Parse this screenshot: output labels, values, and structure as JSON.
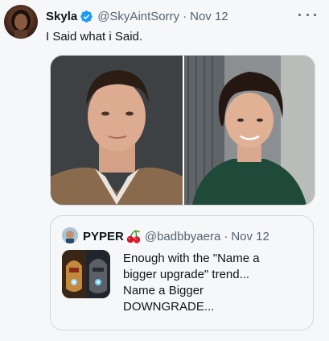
{
  "tweet": {
    "author": {
      "display_name": "Skyla",
      "handle": "@SkyAintSorry",
      "verified": true
    },
    "date": "Nov 12",
    "separator": "·",
    "text": "I Said what i Said.",
    "media_count": 2
  },
  "quoted_tweet": {
    "author": {
      "display_name": "PYPER",
      "name_emoji": "cherries",
      "handle": "@badbbyaera"
    },
    "separator": "·",
    "date": "Nov 12",
    "text_lines": [
      "Enough with the \"Name a",
      "bigger upgrade\" trend...",
      "Name a Bigger",
      "DOWNGRADE..."
    ]
  },
  "icons": {
    "verified": "verified-badge-icon",
    "more": "more-options-icon",
    "cherries": "cherries-icon"
  },
  "colors": {
    "text_primary": "#0f1419",
    "text_secondary": "#536471",
    "verified_blue": "#1d9bf0",
    "border": "#cfd9de",
    "background": "#f6f7f9"
  }
}
